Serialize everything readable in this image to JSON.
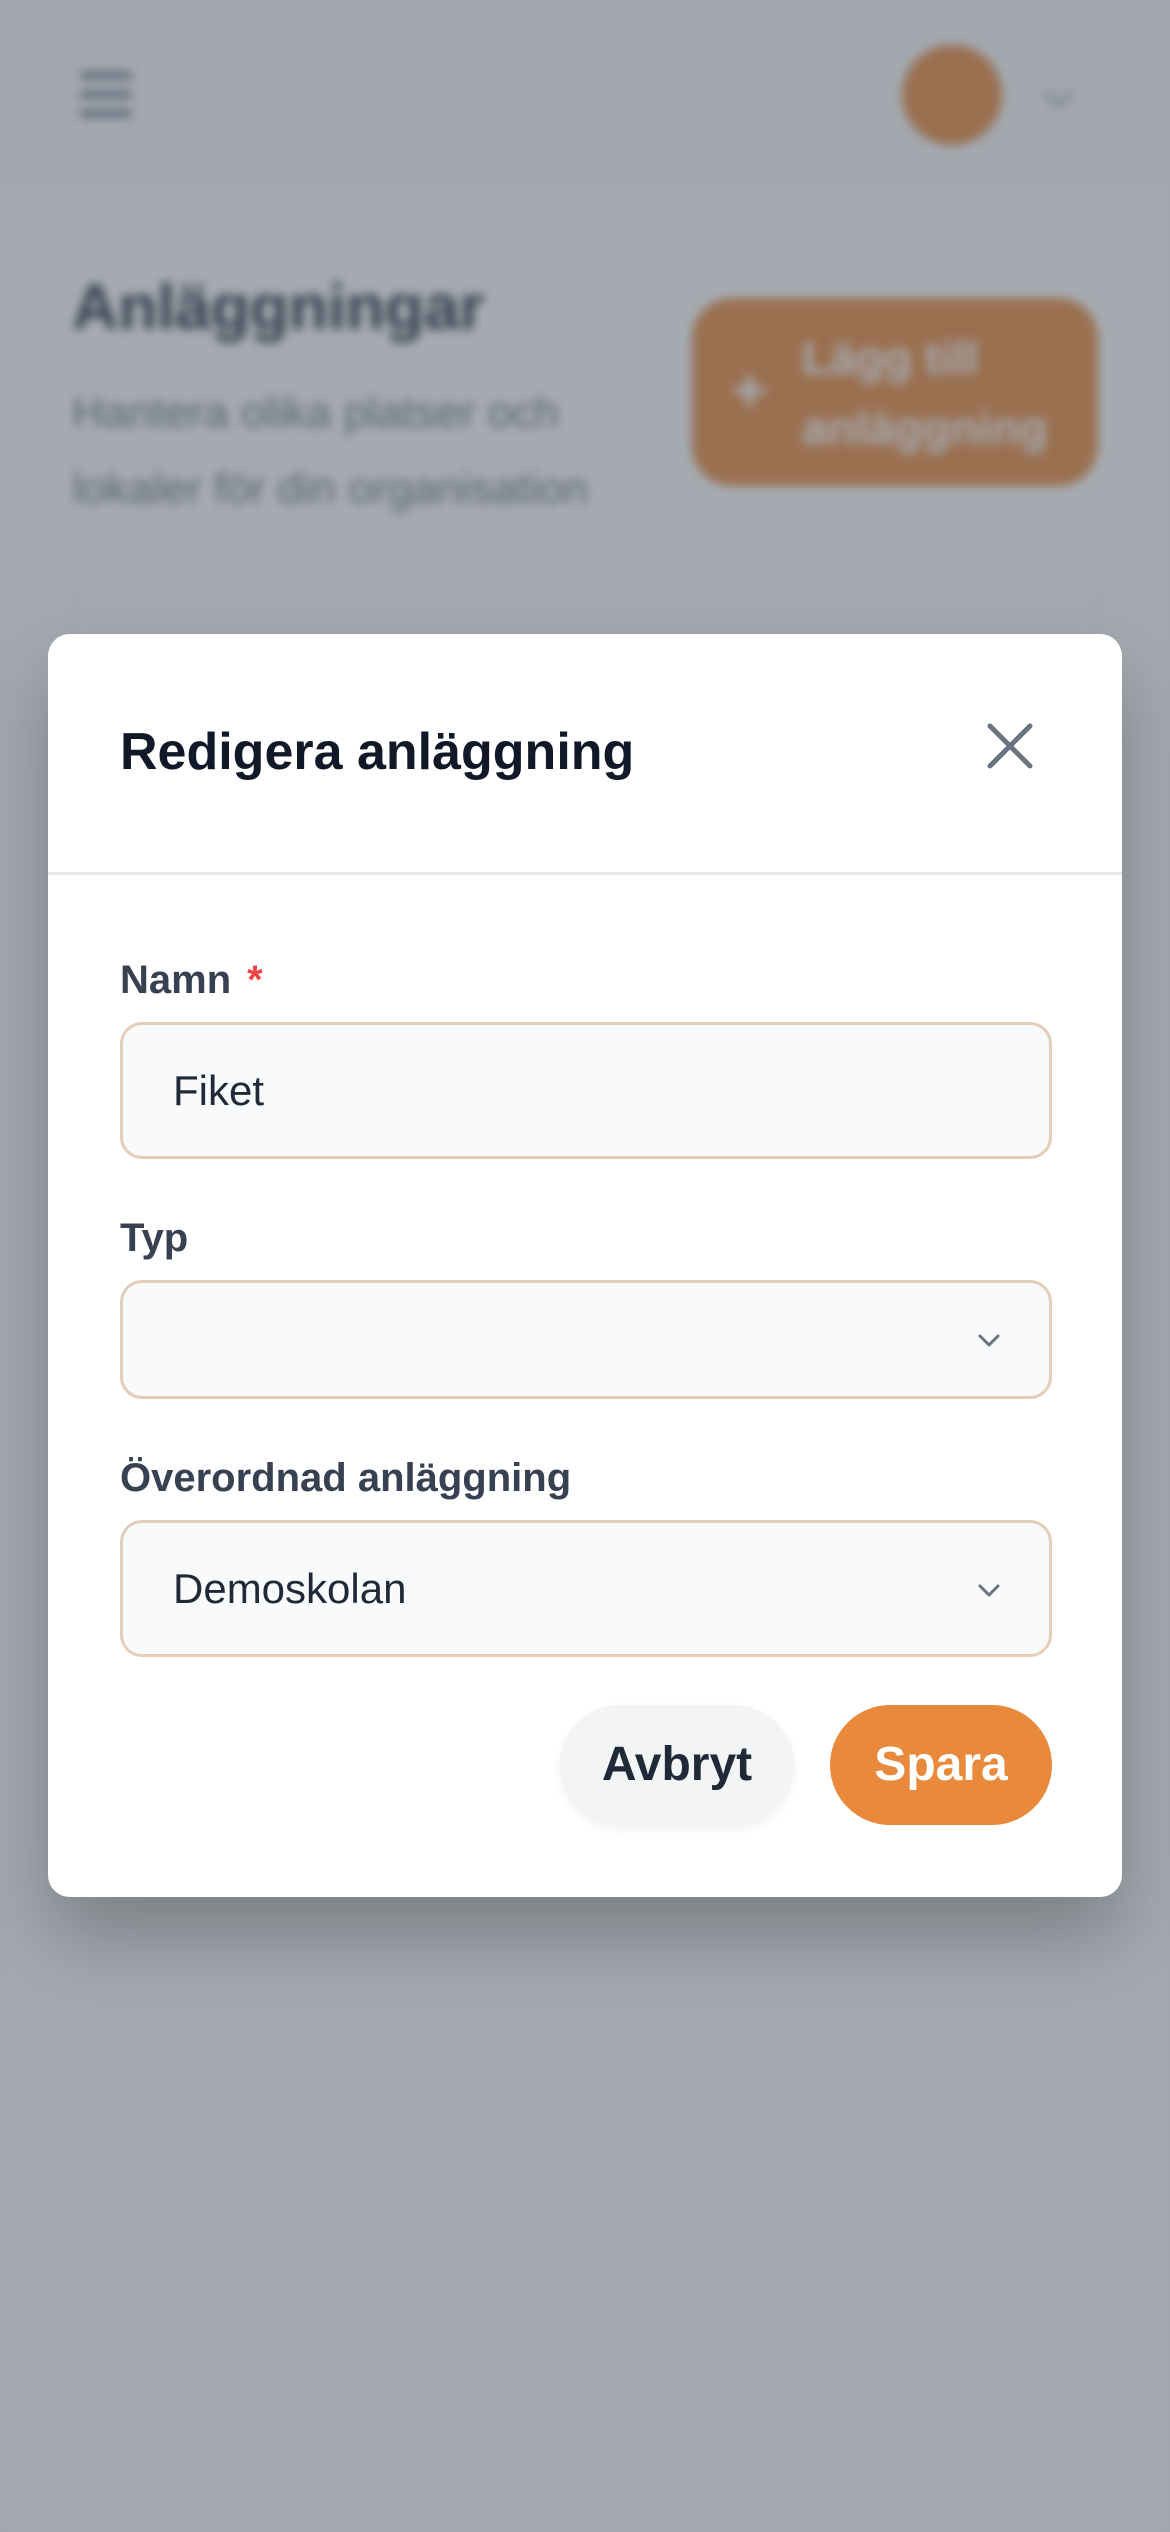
{
  "background": {
    "header": {
      "avatar_initials": "",
      "menu_icon": "hamburger-icon",
      "account_caret_icon": "chevron-down-icon"
    },
    "page_title": "Anläggningar",
    "page_subtitle": "Hantera olika platser och lokaler för din organisation",
    "add_button_label": "Lägg till anläggning"
  },
  "modal": {
    "title": "Redigera anläggning",
    "close_icon": "close-icon",
    "fields": {
      "name": {
        "label": "Namn",
        "required_mark": "*",
        "value": "Fiket"
      },
      "type": {
        "label": "Typ",
        "value": ""
      },
      "parent": {
        "label": "Överordnad anläggning",
        "value": "Demoskolan"
      }
    },
    "buttons": {
      "cancel_label": "Avbryt",
      "save_label": "Spara"
    }
  },
  "colors": {
    "accent": "#e8893b",
    "required": "#ef4444",
    "field_border": "#e3cfb8",
    "overlay": "#9ca3af"
  }
}
